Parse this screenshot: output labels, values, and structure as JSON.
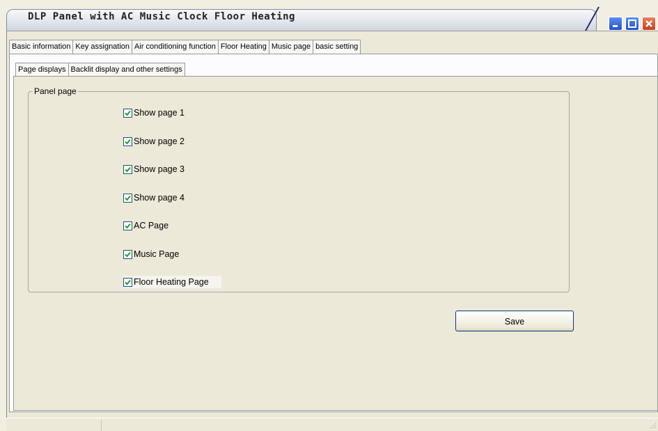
{
  "window": {
    "title": "DLP Panel with AC Music Clock Floor Heating",
    "controls": [
      "minimize-icon",
      "maximize-icon",
      "close-icon"
    ]
  },
  "main_tabs": [
    {
      "label": "Basic information",
      "active": false
    },
    {
      "label": "Key assignation",
      "active": false
    },
    {
      "label": "Air conditioning function",
      "active": false
    },
    {
      "label": "Floor Heating",
      "active": false
    },
    {
      "label": "Music page",
      "active": false
    },
    {
      "label": "basic setting",
      "active": true
    }
  ],
  "sub_tabs": [
    {
      "label": "Page displays",
      "active": true
    },
    {
      "label": "Backlit display and other settings",
      "active": false
    }
  ],
  "panel_group": {
    "title": "Panel page",
    "checkboxes": [
      {
        "label": "Show page 1",
        "checked": true
      },
      {
        "label": "Show page 2",
        "checked": true
      },
      {
        "label": "Show page 3",
        "checked": true
      },
      {
        "label": "Show page 4",
        "checked": true
      },
      {
        "label": "AC Page",
        "checked": true
      },
      {
        "label": "Music Page",
        "checked": true
      },
      {
        "label": "Floor Heating Page",
        "checked": true
      }
    ]
  },
  "save_label": "Save",
  "colors": {
    "check": "#21a121",
    "title_accent": "#2151c9",
    "close": "#c8401d"
  }
}
